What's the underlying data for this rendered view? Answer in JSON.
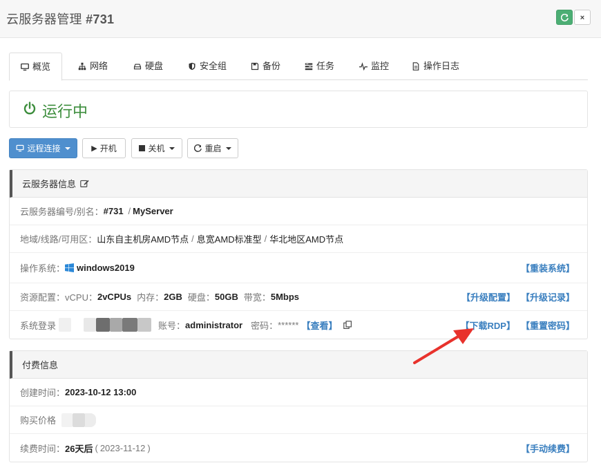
{
  "titlebar": {
    "title": "云服务器管理 ",
    "id": "#731",
    "refresh_icon": "refresh-icon",
    "close_label": "×"
  },
  "tabs": [
    {
      "label": "概览",
      "icon": "monitor-icon",
      "active": true
    },
    {
      "label": "网络",
      "icon": "network-icon"
    },
    {
      "label": "硬盘",
      "icon": "harddisk-icon"
    },
    {
      "label": "安全组",
      "icon": "shield-icon"
    },
    {
      "label": "备份",
      "icon": "save-icon"
    },
    {
      "label": "任务",
      "icon": "tasks-icon"
    },
    {
      "label": "监控",
      "icon": "pulse-icon"
    },
    {
      "label": "操作日志",
      "icon": "file-icon"
    }
  ],
  "status": {
    "text": "运行中",
    "color": "#3c8d3c"
  },
  "buttons": {
    "remote": "远程连接",
    "start": "开机",
    "shutdown": "关机",
    "reboot": "重启"
  },
  "info": {
    "header": "云服务器信息",
    "id_label": "云服务器编号/别名：",
    "id_value": "#731",
    "alias": "MyServer",
    "region_label": "地域/线路/可用区：",
    "region": "山东自主机房AMD节点",
    "line": "息宽AMD标准型",
    "zone": "华北地区AMD节点",
    "os_label": "操作系统：",
    "os": "windows2019",
    "reinstall": "【重装系统】",
    "res_label": "资源配置：",
    "vcpu_label": "vCPU：",
    "vcpu": "2vCPUs",
    "mem_label": "内存：",
    "mem": "2GB",
    "disk_label": "硬盘：",
    "disk": "50GB",
    "bw_label": "带宽：",
    "bw": "5Mbps",
    "upgrade": "【升级配置】",
    "upgrade_log": "【升级记录】",
    "login_label": "系统登录",
    "account_label": "账号：",
    "account": "administrator",
    "password_label": "密码：",
    "password_mask": "******",
    "view": "【查看】",
    "download_rdp": "【下载RDP】",
    "reset_pwd": "【重置密码】"
  },
  "billing": {
    "header": "付费信息",
    "created_label": "创建时间：",
    "created": "2023-10-12 13:00",
    "price_label": "购买价格",
    "renew_label": "续费时间：",
    "renew_days": "26天后",
    "renew_date": "2023-11-12",
    "manual_renew": "【手动续费】"
  },
  "colors": {
    "primary": "#4f8fce",
    "link": "#3a7fbf",
    "arrow": "#e8322c",
    "refresh": "#4cae74"
  }
}
